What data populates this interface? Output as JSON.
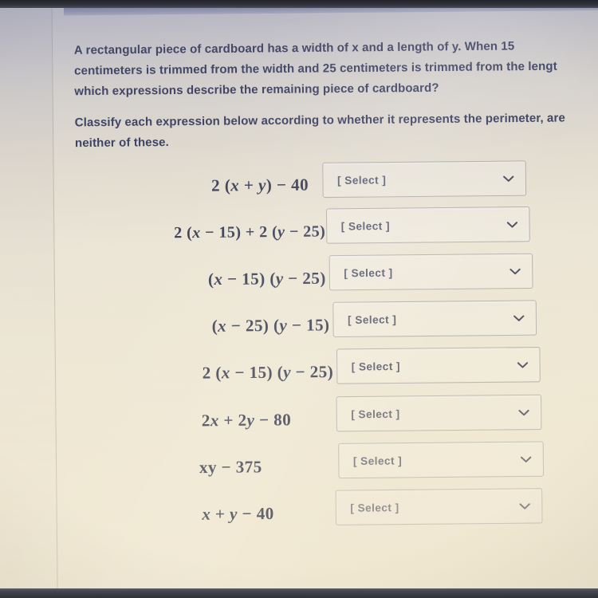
{
  "document": {
    "prompt_lines": [
      "A rectangular piece of cardboard has a width of x and a length of y. When 15",
      "centimeters is trimmed from the width and 25 centimeters is trimmed from the lengt",
      "which expressions describe the remaining piece of cardboard?",
      "Classify each expression below according to whether it represents the perimeter, are",
      "neither of these."
    ],
    "select_placeholder": "[ Select ]",
    "chevron_icon": "chevron-down-icon",
    "rows": [
      {
        "expression": "2 (x + y) − 40",
        "selected": "[ Select ]"
      },
      {
        "expression": "2 (x − 15) + 2 (y − 25)",
        "selected": "[ Select ]"
      },
      {
        "expression": "(x − 15) (y − 25)",
        "selected": "[ Select ]"
      },
      {
        "expression": "(x − 25) (y − 15)",
        "selected": "[ Select ]"
      },
      {
        "expression": "2 (x − 15) (y − 25)",
        "selected": "[ Select ]"
      },
      {
        "expression": "2x + 2y − 80",
        "selected": "[ Select ]"
      },
      {
        "expression": "xy − 375",
        "selected": "[ Select ]"
      },
      {
        "expression": "x + y − 40",
        "selected": "[ Select ]"
      }
    ]
  },
  "colors": {
    "text": "#3c4161",
    "expression_text": "#3e4258",
    "placeholder_text": "#5e6075",
    "header_band": "#8e91ad",
    "page_background": "#ece6d7",
    "dropdown_border": "#78767d"
  }
}
